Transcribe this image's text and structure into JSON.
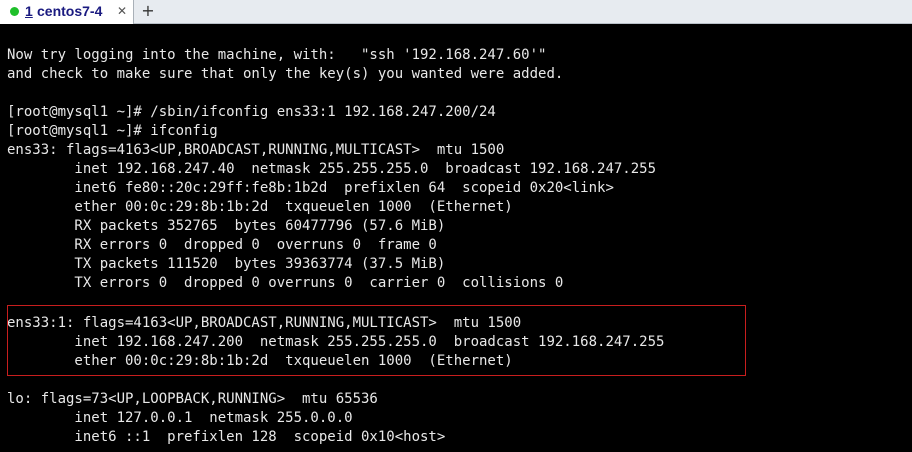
{
  "tab": {
    "number": "1",
    "name": "centos7-4",
    "close_glyph": "✕",
    "new_tab_glyph": "+"
  },
  "colors": {
    "status": "#1fbf2a",
    "highlight": "#c81e1e",
    "terminal_bg": "#000000",
    "terminal_fg": "#e8e8e8"
  },
  "terminal": {
    "lines": [
      "Now try logging into the machine, with:   \"ssh '192.168.247.60'\"",
      "and check to make sure that only the key(s) you wanted were added.",
      "",
      "[root@mysql1 ~]# /sbin/ifconfig ens33:1 192.168.247.200/24",
      "[root@mysql1 ~]# ifconfig",
      "ens33: flags=4163<UP,BROADCAST,RUNNING,MULTICAST>  mtu 1500",
      "        inet 192.168.247.40  netmask 255.255.255.0  broadcast 192.168.247.255",
      "        inet6 fe80::20c:29ff:fe8b:1b2d  prefixlen 64  scopeid 0x20<link>",
      "        ether 00:0c:29:8b:1b:2d  txqueuelen 1000  (Ethernet)",
      "        RX packets 352765  bytes 60477796 (57.6 MiB)",
      "        RX errors 0  dropped 0  overruns 0  frame 0",
      "        TX packets 111520  bytes 39363774 (37.5 MiB)",
      "        TX errors 0  dropped 0 overruns 0  carrier 0  collisions 0",
      "",
      "ens33:1: flags=4163<UP,BROADCAST,RUNNING,MULTICAST>  mtu 1500",
      "        inet 192.168.247.200  netmask 255.255.255.0  broadcast 192.168.247.255",
      "        ether 00:0c:29:8b:1b:2d  txqueuelen 1000  (Ethernet)",
      "",
      "lo: flags=73<UP,LOOPBACK,RUNNING>  mtu 65536",
      "        inet 127.0.0.1  netmask 255.0.0.0",
      "        inet6 ::1  prefixlen 128  scopeid 0x10<host>"
    ]
  }
}
